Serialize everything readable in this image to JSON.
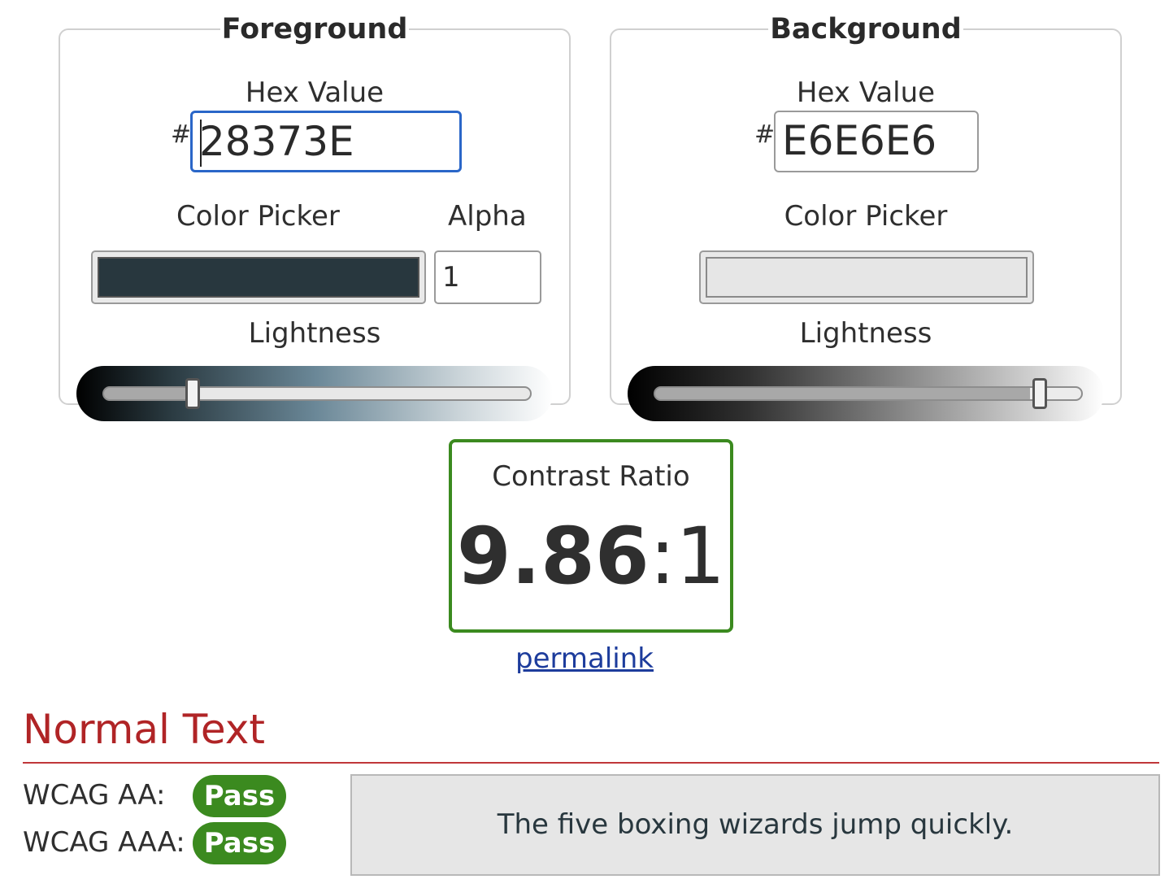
{
  "foreground": {
    "legend": "Foreground",
    "hex_label": "Hex Value",
    "hash": "#",
    "hex_value": "28373E",
    "color_picker_label": "Color Picker",
    "alpha_label": "Alpha",
    "alpha_value": "1",
    "lightness_label": "Lightness",
    "swatch_color": "#28373e",
    "lightness_level": 0.21
  },
  "background": {
    "legend": "Background",
    "hex_label": "Hex Value",
    "hash": "#",
    "hex_value": "E6E6E6",
    "color_picker_label": "Color Picker",
    "lightness_label": "Lightness",
    "swatch_color": "#e6e6e6",
    "lightness_level": 0.9
  },
  "contrast": {
    "label": "Contrast Ratio",
    "ratio_number": "9.86",
    "ratio_suffix": ":1",
    "border_color": "#3b8a1f"
  },
  "permalink": "permalink",
  "normal_text": {
    "title": "Normal Text",
    "aa_label": "WCAG AA:",
    "aa_result": "Pass",
    "aaa_label": "WCAG AAA:",
    "aaa_result": "Pass",
    "pass_color": "#3b8a1f",
    "sample_text": "The five boxing wizards jump quickly."
  }
}
